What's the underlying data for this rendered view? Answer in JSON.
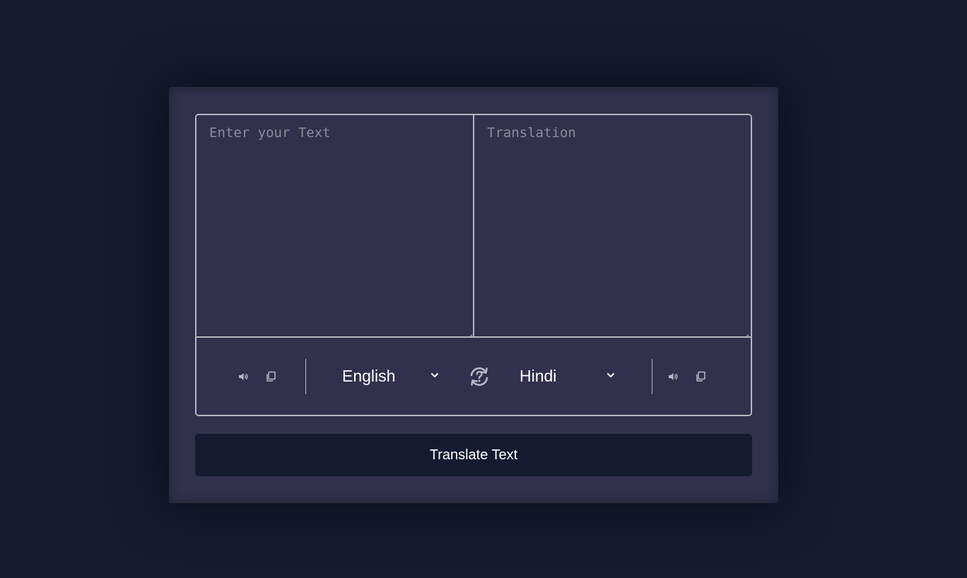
{
  "source": {
    "placeholder": "Enter your Text",
    "value": "",
    "language": "English"
  },
  "target": {
    "placeholder": "Translation",
    "value": "",
    "language": "Hindi"
  },
  "icons": {
    "speak": "volume-icon",
    "copy": "copy-icon",
    "swap": "swap-languages-icon",
    "dropdown": "chevron-down-icon"
  },
  "actions": {
    "translate_label": "Translate Text"
  },
  "colors": {
    "page_background": "#161a30",
    "card_background": "#31304d",
    "border": "#b6b6c2",
    "button_background": "#161a30",
    "text": "#ffffff"
  }
}
